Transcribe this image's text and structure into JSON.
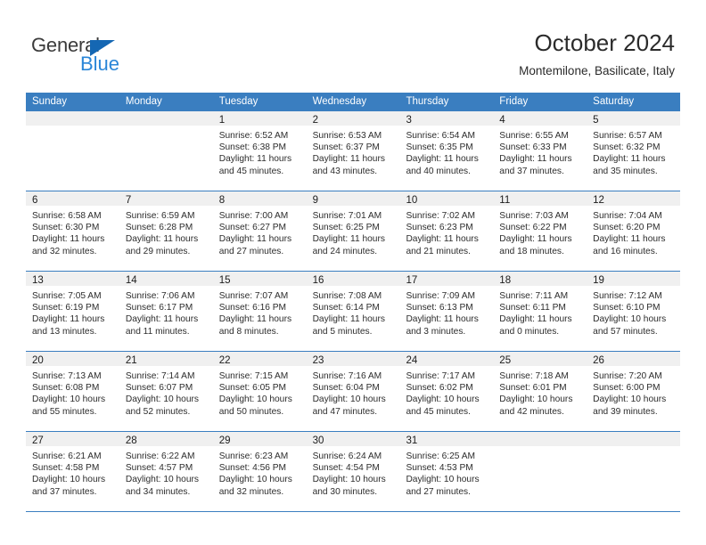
{
  "brand": {
    "name_part1": "General",
    "name_part2": "Blue",
    "color_dark": "#3b3b3b",
    "color_blue": "#2a86d8",
    "triangle_color": "#1567b3"
  },
  "header": {
    "title": "October 2024",
    "subtitle": "Montemilone, Basilicate, Italy"
  },
  "theme": {
    "header_row_bg": "#3a7ec0",
    "header_row_text": "#ffffff",
    "daynum_band_bg": "#f0f0f0",
    "grid_line": "#3a7ec0",
    "body_text": "#2c2c2c"
  },
  "weekdays": [
    "Sunday",
    "Monday",
    "Tuesday",
    "Wednesday",
    "Thursday",
    "Friday",
    "Saturday"
  ],
  "weeks": [
    [
      {
        "day": "",
        "lines": []
      },
      {
        "day": "",
        "lines": []
      },
      {
        "day": "1",
        "lines": [
          "Sunrise: 6:52 AM",
          "Sunset: 6:38 PM",
          "Daylight: 11 hours",
          "and 45 minutes."
        ]
      },
      {
        "day": "2",
        "lines": [
          "Sunrise: 6:53 AM",
          "Sunset: 6:37 PM",
          "Daylight: 11 hours",
          "and 43 minutes."
        ]
      },
      {
        "day": "3",
        "lines": [
          "Sunrise: 6:54 AM",
          "Sunset: 6:35 PM",
          "Daylight: 11 hours",
          "and 40 minutes."
        ]
      },
      {
        "day": "4",
        "lines": [
          "Sunrise: 6:55 AM",
          "Sunset: 6:33 PM",
          "Daylight: 11 hours",
          "and 37 minutes."
        ]
      },
      {
        "day": "5",
        "lines": [
          "Sunrise: 6:57 AM",
          "Sunset: 6:32 PM",
          "Daylight: 11 hours",
          "and 35 minutes."
        ]
      }
    ],
    [
      {
        "day": "6",
        "lines": [
          "Sunrise: 6:58 AM",
          "Sunset: 6:30 PM",
          "Daylight: 11 hours",
          "and 32 minutes."
        ]
      },
      {
        "day": "7",
        "lines": [
          "Sunrise: 6:59 AM",
          "Sunset: 6:28 PM",
          "Daylight: 11 hours",
          "and 29 minutes."
        ]
      },
      {
        "day": "8",
        "lines": [
          "Sunrise: 7:00 AM",
          "Sunset: 6:27 PM",
          "Daylight: 11 hours",
          "and 27 minutes."
        ]
      },
      {
        "day": "9",
        "lines": [
          "Sunrise: 7:01 AM",
          "Sunset: 6:25 PM",
          "Daylight: 11 hours",
          "and 24 minutes."
        ]
      },
      {
        "day": "10",
        "lines": [
          "Sunrise: 7:02 AM",
          "Sunset: 6:23 PM",
          "Daylight: 11 hours",
          "and 21 minutes."
        ]
      },
      {
        "day": "11",
        "lines": [
          "Sunrise: 7:03 AM",
          "Sunset: 6:22 PM",
          "Daylight: 11 hours",
          "and 18 minutes."
        ]
      },
      {
        "day": "12",
        "lines": [
          "Sunrise: 7:04 AM",
          "Sunset: 6:20 PM",
          "Daylight: 11 hours",
          "and 16 minutes."
        ]
      }
    ],
    [
      {
        "day": "13",
        "lines": [
          "Sunrise: 7:05 AM",
          "Sunset: 6:19 PM",
          "Daylight: 11 hours",
          "and 13 minutes."
        ]
      },
      {
        "day": "14",
        "lines": [
          "Sunrise: 7:06 AM",
          "Sunset: 6:17 PM",
          "Daylight: 11 hours",
          "and 11 minutes."
        ]
      },
      {
        "day": "15",
        "lines": [
          "Sunrise: 7:07 AM",
          "Sunset: 6:16 PM",
          "Daylight: 11 hours",
          "and 8 minutes."
        ]
      },
      {
        "day": "16",
        "lines": [
          "Sunrise: 7:08 AM",
          "Sunset: 6:14 PM",
          "Daylight: 11 hours",
          "and 5 minutes."
        ]
      },
      {
        "day": "17",
        "lines": [
          "Sunrise: 7:09 AM",
          "Sunset: 6:13 PM",
          "Daylight: 11 hours",
          "and 3 minutes."
        ]
      },
      {
        "day": "18",
        "lines": [
          "Sunrise: 7:11 AM",
          "Sunset: 6:11 PM",
          "Daylight: 11 hours",
          "and 0 minutes."
        ]
      },
      {
        "day": "19",
        "lines": [
          "Sunrise: 7:12 AM",
          "Sunset: 6:10 PM",
          "Daylight: 10 hours",
          "and 57 minutes."
        ]
      }
    ],
    [
      {
        "day": "20",
        "lines": [
          "Sunrise: 7:13 AM",
          "Sunset: 6:08 PM",
          "Daylight: 10 hours",
          "and 55 minutes."
        ]
      },
      {
        "day": "21",
        "lines": [
          "Sunrise: 7:14 AM",
          "Sunset: 6:07 PM",
          "Daylight: 10 hours",
          "and 52 minutes."
        ]
      },
      {
        "day": "22",
        "lines": [
          "Sunrise: 7:15 AM",
          "Sunset: 6:05 PM",
          "Daylight: 10 hours",
          "and 50 minutes."
        ]
      },
      {
        "day": "23",
        "lines": [
          "Sunrise: 7:16 AM",
          "Sunset: 6:04 PM",
          "Daylight: 10 hours",
          "and 47 minutes."
        ]
      },
      {
        "day": "24",
        "lines": [
          "Sunrise: 7:17 AM",
          "Sunset: 6:02 PM",
          "Daylight: 10 hours",
          "and 45 minutes."
        ]
      },
      {
        "day": "25",
        "lines": [
          "Sunrise: 7:18 AM",
          "Sunset: 6:01 PM",
          "Daylight: 10 hours",
          "and 42 minutes."
        ]
      },
      {
        "day": "26",
        "lines": [
          "Sunrise: 7:20 AM",
          "Sunset: 6:00 PM",
          "Daylight: 10 hours",
          "and 39 minutes."
        ]
      }
    ],
    [
      {
        "day": "27",
        "lines": [
          "Sunrise: 6:21 AM",
          "Sunset: 4:58 PM",
          "Daylight: 10 hours",
          "and 37 minutes."
        ]
      },
      {
        "day": "28",
        "lines": [
          "Sunrise: 6:22 AM",
          "Sunset: 4:57 PM",
          "Daylight: 10 hours",
          "and 34 minutes."
        ]
      },
      {
        "day": "29",
        "lines": [
          "Sunrise: 6:23 AM",
          "Sunset: 4:56 PM",
          "Daylight: 10 hours",
          "and 32 minutes."
        ]
      },
      {
        "day": "30",
        "lines": [
          "Sunrise: 6:24 AM",
          "Sunset: 4:54 PM",
          "Daylight: 10 hours",
          "and 30 minutes."
        ]
      },
      {
        "day": "31",
        "lines": [
          "Sunrise: 6:25 AM",
          "Sunset: 4:53 PM",
          "Daylight: 10 hours",
          "and 27 minutes."
        ]
      },
      {
        "day": "",
        "lines": []
      },
      {
        "day": "",
        "lines": []
      }
    ]
  ]
}
